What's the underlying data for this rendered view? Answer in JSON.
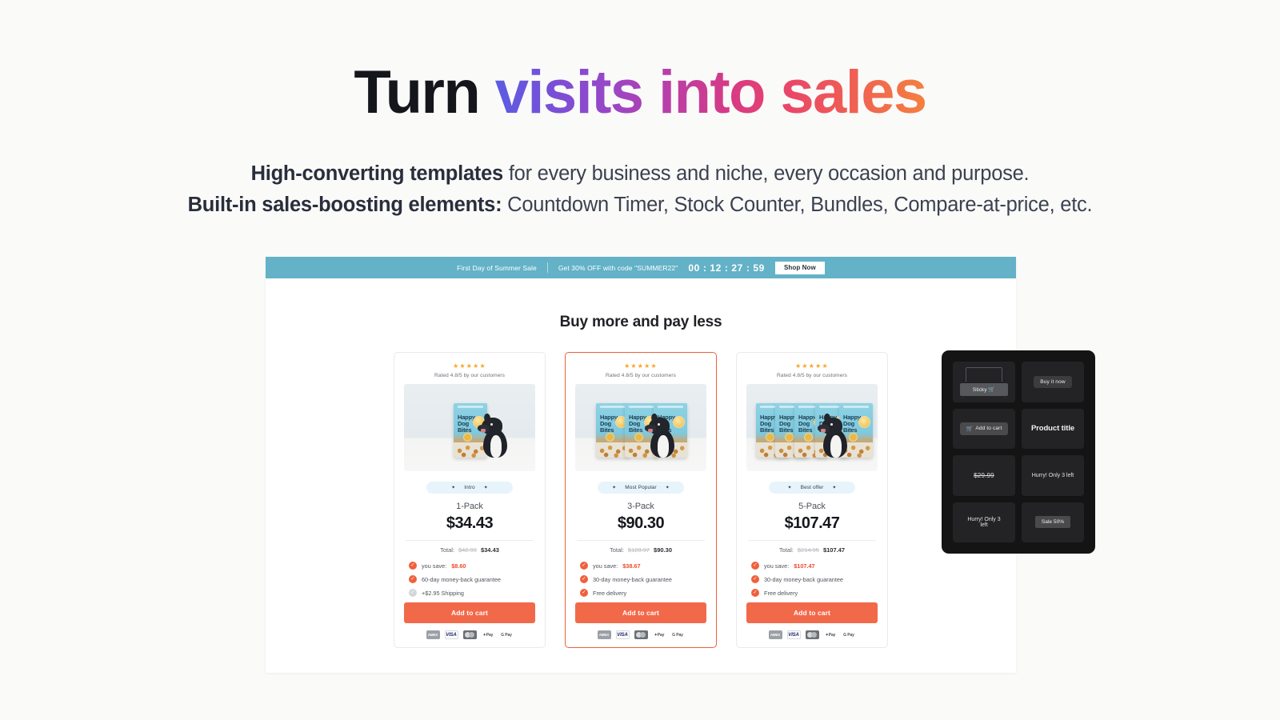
{
  "hero": {
    "headline_black": "Turn ",
    "headline_gradient": "visits into sales",
    "sub_line1_bold": "High-converting templates",
    "sub_line1_rest": " for every business and niche, every occasion and purpose.",
    "sub_line2_bold": "Built-in sales-boosting elements:",
    "sub_line2_rest": " Countdown Timer, Stock Counter, Bundles, Compare-at-price, etc."
  },
  "announcement_bar": {
    "title": "First Day of Summer Sale",
    "offer": "Get 30% OFF with code \"SUMMER22\"",
    "timer": "00 : 12 : 27 : 59",
    "cta": "Shop Now",
    "background": "#63b2c7"
  },
  "store": {
    "section_title": "Buy more and pay less",
    "rating_stars": "★★★★★",
    "rating_text": "Rated 4.8/5 by our customers",
    "product_name_lines": [
      "Happy",
      "Dog",
      "Bites"
    ],
    "add_to_cart_label": "Add to cart",
    "total_label": "Total:",
    "badge_star": "✦",
    "tick_glyph": "✓",
    "payments": [
      {
        "name": "amex-icon",
        "label": "AMEX"
      },
      {
        "name": "visa-icon",
        "label": "VISA"
      },
      {
        "name": "mastercard-icon",
        "label": ""
      },
      {
        "name": "apple-pay-icon",
        "label": "✦Pay"
      },
      {
        "name": "google-pay-icon",
        "label": "G Pay"
      }
    ],
    "cards": [
      {
        "badge": "Intro",
        "pack": "1-Pack",
        "price": "$34.43",
        "total_old": "$42.99",
        "total_new": "$34.43",
        "perks": [
          {
            "text_prefix": "you save: ",
            "highlight": "$8.60",
            "state": "on"
          },
          {
            "text_prefix": "60-day money-back guarantee",
            "highlight": "",
            "state": "on"
          },
          {
            "text_prefix": "+$2.95 Shipping",
            "highlight": "",
            "state": "off"
          }
        ],
        "featured": false
      },
      {
        "badge": "Most Popular",
        "pack": "3-Pack",
        "price": "$90.30",
        "total_old": "$128.97",
        "total_new": "$90.30",
        "perks": [
          {
            "text_prefix": "you save: ",
            "highlight": "$38.67",
            "state": "on"
          },
          {
            "text_prefix": "30-day money-back guarantee",
            "highlight": "",
            "state": "on"
          },
          {
            "text_prefix": "Free delivery",
            "highlight": "",
            "state": "on"
          }
        ],
        "featured": true
      },
      {
        "badge": "Best offer",
        "pack": "5-Pack",
        "price": "$107.47",
        "total_old": "$214.95",
        "total_new": "$107.47",
        "perks": [
          {
            "text_prefix": "you save: ",
            "highlight": "$107.47",
            "state": "on"
          },
          {
            "text_prefix": "30-day money-back guarantee",
            "highlight": "",
            "state": "on"
          },
          {
            "text_prefix": "Free delivery",
            "highlight": "",
            "state": "on"
          }
        ],
        "featured": false
      }
    ]
  },
  "widgets": {
    "sticky_label": "Sticky",
    "buy_it_now": "Buy it now",
    "add_to_cart": "Add to cart",
    "product_title": "Product title",
    "compare_price": "$29.99",
    "stock_text": "Hurry! Only 3 left",
    "stock_text_bar": "Hurry! Only 3 left",
    "sale_badge": "Sale 50%",
    "cart_glyph": "🛒"
  },
  "colors": {
    "page_bg": "#fafaf9",
    "accent_orange": "#f2694a",
    "announce_blue": "#63b2c7",
    "badge_blue": "#e8f4fb",
    "panel_dark": "#141415"
  }
}
